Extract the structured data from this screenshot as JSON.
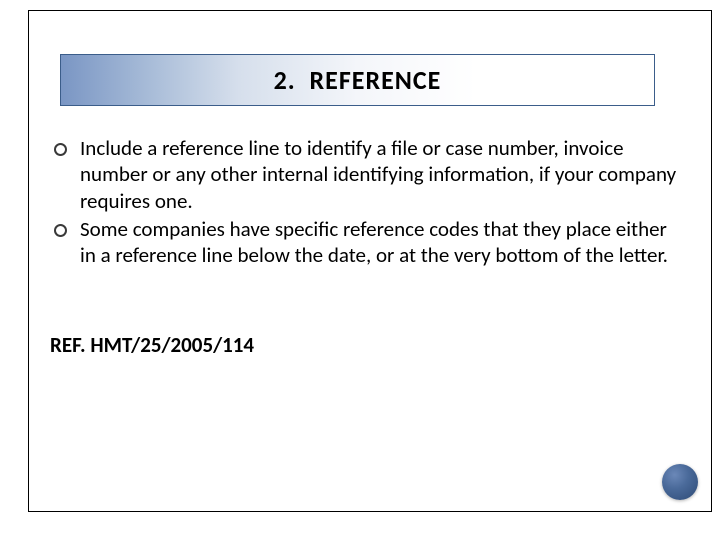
{
  "title": {
    "number": "2.",
    "word_first": "R",
    "word_rest": "EFERENCE"
  },
  "bullets": [
    "Include a reference line to identify a file or case number, invoice number or any other internal identifying information, if your company requires one.",
    "Some companies have specific reference codes that they place either in a reference line below the date, or at the very bottom of the letter."
  ],
  "reference_example": "REF. HMT/25/2005/114"
}
